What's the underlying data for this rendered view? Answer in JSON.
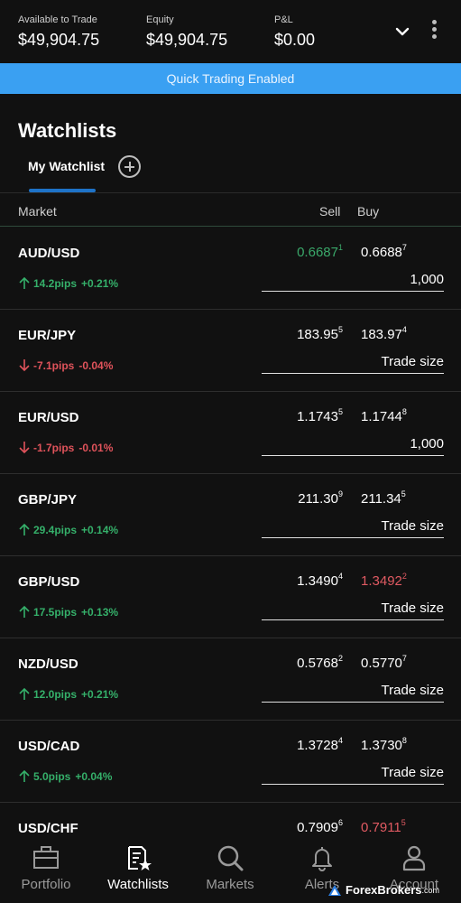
{
  "account": {
    "available_label": "Available to Trade",
    "available_value": "$49,904.75",
    "equity_label": "Equity",
    "equity_value": "$49,904.75",
    "pnl_label": "P&L",
    "pnl_value": "$0.00"
  },
  "banner": "Quick Trading Enabled",
  "watchlists": {
    "title": "Watchlists",
    "active_tab": "My Watchlist"
  },
  "columns": {
    "market": "Market",
    "sell": "Sell",
    "buy": "Buy"
  },
  "rows": [
    {
      "symbol": "AUD/USD",
      "direction": "up",
      "pips": "14.2pips",
      "pct": "+0.21%",
      "sell_main": "0.6687",
      "sell_sup": "1",
      "sell_color": "#3aa86a",
      "buy_main": "0.6688",
      "buy_sup": "7",
      "buy_color": "#ffffff",
      "size": "1,000"
    },
    {
      "symbol": "EUR/JPY",
      "direction": "down",
      "pips": "-7.1pips",
      "pct": "-0.04%",
      "sell_main": "183.95",
      "sell_sup": "5",
      "sell_color": "#ffffff",
      "buy_main": "183.97",
      "buy_sup": "4",
      "buy_color": "#ffffff",
      "size": "Trade size"
    },
    {
      "symbol": "EUR/USD",
      "direction": "down",
      "pips": "-1.7pips",
      "pct": "-0.01%",
      "sell_main": "1.1743",
      "sell_sup": "5",
      "sell_color": "#ffffff",
      "buy_main": "1.1744",
      "buy_sup": "8",
      "buy_color": "#ffffff",
      "size": "1,000"
    },
    {
      "symbol": "GBP/JPY",
      "direction": "up",
      "pips": "29.4pips",
      "pct": "+0.14%",
      "sell_main": "211.30",
      "sell_sup": "9",
      "sell_color": "#ffffff",
      "buy_main": "211.34",
      "buy_sup": "5",
      "buy_color": "#ffffff",
      "size": "Trade size"
    },
    {
      "symbol": "GBP/USD",
      "direction": "up",
      "pips": "17.5pips",
      "pct": "+0.13%",
      "sell_main": "1.3490",
      "sell_sup": "4",
      "sell_color": "#ffffff",
      "buy_main": "1.3492",
      "buy_sup": "2",
      "buy_color": "#e05a62",
      "size": "Trade size"
    },
    {
      "symbol": "NZD/USD",
      "direction": "up",
      "pips": "12.0pips",
      "pct": "+0.21%",
      "sell_main": "0.5768",
      "sell_sup": "2",
      "sell_color": "#ffffff",
      "buy_main": "0.5770",
      "buy_sup": "7",
      "buy_color": "#ffffff",
      "size": "Trade size"
    },
    {
      "symbol": "USD/CAD",
      "direction": "up",
      "pips": "5.0pips",
      "pct": "+0.04%",
      "sell_main": "1.3728",
      "sell_sup": "4",
      "sell_color": "#ffffff",
      "buy_main": "1.3730",
      "buy_sup": "8",
      "buy_color": "#ffffff",
      "size": "Trade size"
    },
    {
      "symbol": "USD/CHF",
      "direction": "",
      "pips": "",
      "pct": "",
      "sell_main": "0.7909",
      "sell_sup": "6",
      "sell_color": "#ffffff",
      "buy_main": "0.7911",
      "buy_sup": "5",
      "buy_color": "#e05a62",
      "size": ""
    }
  ],
  "nav": [
    {
      "label": "Portfolio",
      "icon": "portfolio-icon"
    },
    {
      "label": "Watchlists",
      "icon": "watchlists-icon",
      "active": true
    },
    {
      "label": "Markets",
      "icon": "search-icon"
    },
    {
      "label": "Alerts",
      "icon": "bell-icon"
    },
    {
      "label": "Account",
      "icon": "person-icon"
    }
  ],
  "watermark": {
    "text": "ForexBrokers",
    "suffix": ".com"
  }
}
